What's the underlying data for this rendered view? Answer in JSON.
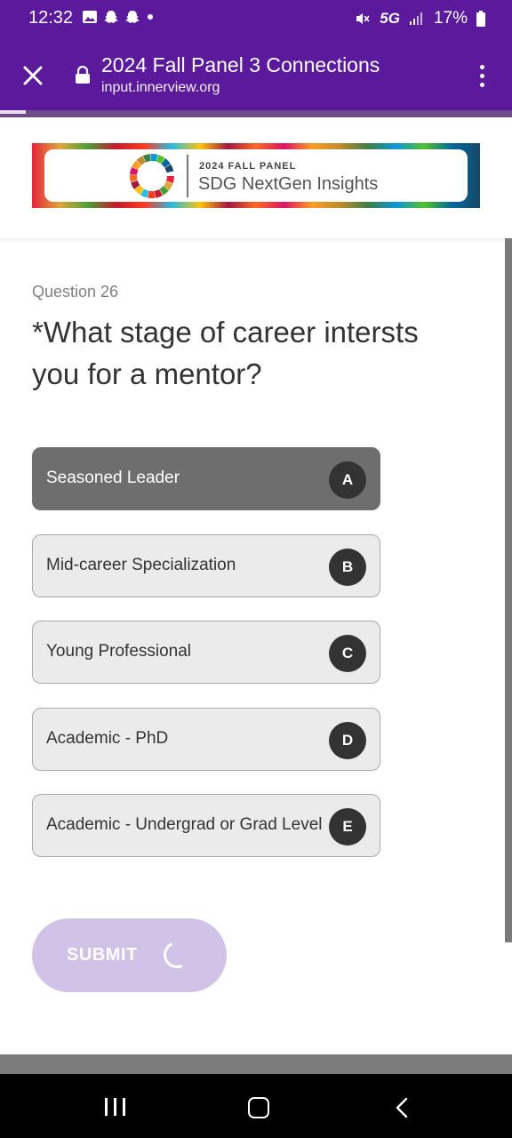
{
  "status_bar": {
    "time": "12:32",
    "network": "5G",
    "battery": "17%"
  },
  "browser": {
    "title": "2024 Fall Panel 3 Connections",
    "url": "input.innerview.org",
    "load_progress": 0.05
  },
  "banner": {
    "kicker": "2024 FALL PANEL",
    "title": "SDG NextGen Insights"
  },
  "question": {
    "number": "Question 26",
    "text": "*What stage of career intersts you for a mentor?"
  },
  "options": [
    {
      "label": "Seasoned Leader",
      "key": "A",
      "selected": true
    },
    {
      "label": "Mid-career Specialization",
      "key": "B",
      "selected": false
    },
    {
      "label": "Young Professional",
      "key": "C",
      "selected": false
    },
    {
      "label": "Academic - PhD",
      "key": "D",
      "selected": false
    },
    {
      "label": "Academic - Undergrad or Grad Level",
      "key": "E",
      "selected": false
    }
  ],
  "submit": {
    "label": "SUBMIT"
  },
  "colors": {
    "brand": "#5b1a9c",
    "selected_option": "#6e6e6e",
    "submit_disabled": "#d1c3e7"
  }
}
